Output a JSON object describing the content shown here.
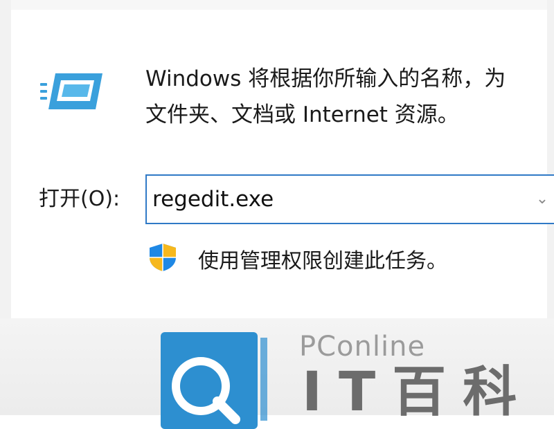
{
  "dialog": {
    "description_line1": "Windows 将根据你所输入的名称，为",
    "description_line2": "文件夹、文档或 Internet 资源。",
    "open_label": "打开(O):",
    "open_value": "regedit.exe",
    "admin_note": "使用管理权限创建此任务。"
  },
  "icons": {
    "run": "run-dialog-icon",
    "shield": "uac-shield-icon",
    "dropdown": "chevron-down-icon"
  },
  "watermark": {
    "brand": "PConline",
    "glyphs": "IT百科"
  },
  "colors": {
    "accent": "#2f79c6",
    "icon_blue": "#3aa0dc",
    "shield_blue": "#1e88e5",
    "shield_yellow": "#f6b81d",
    "watermark_blue": "#2d8fd0"
  }
}
